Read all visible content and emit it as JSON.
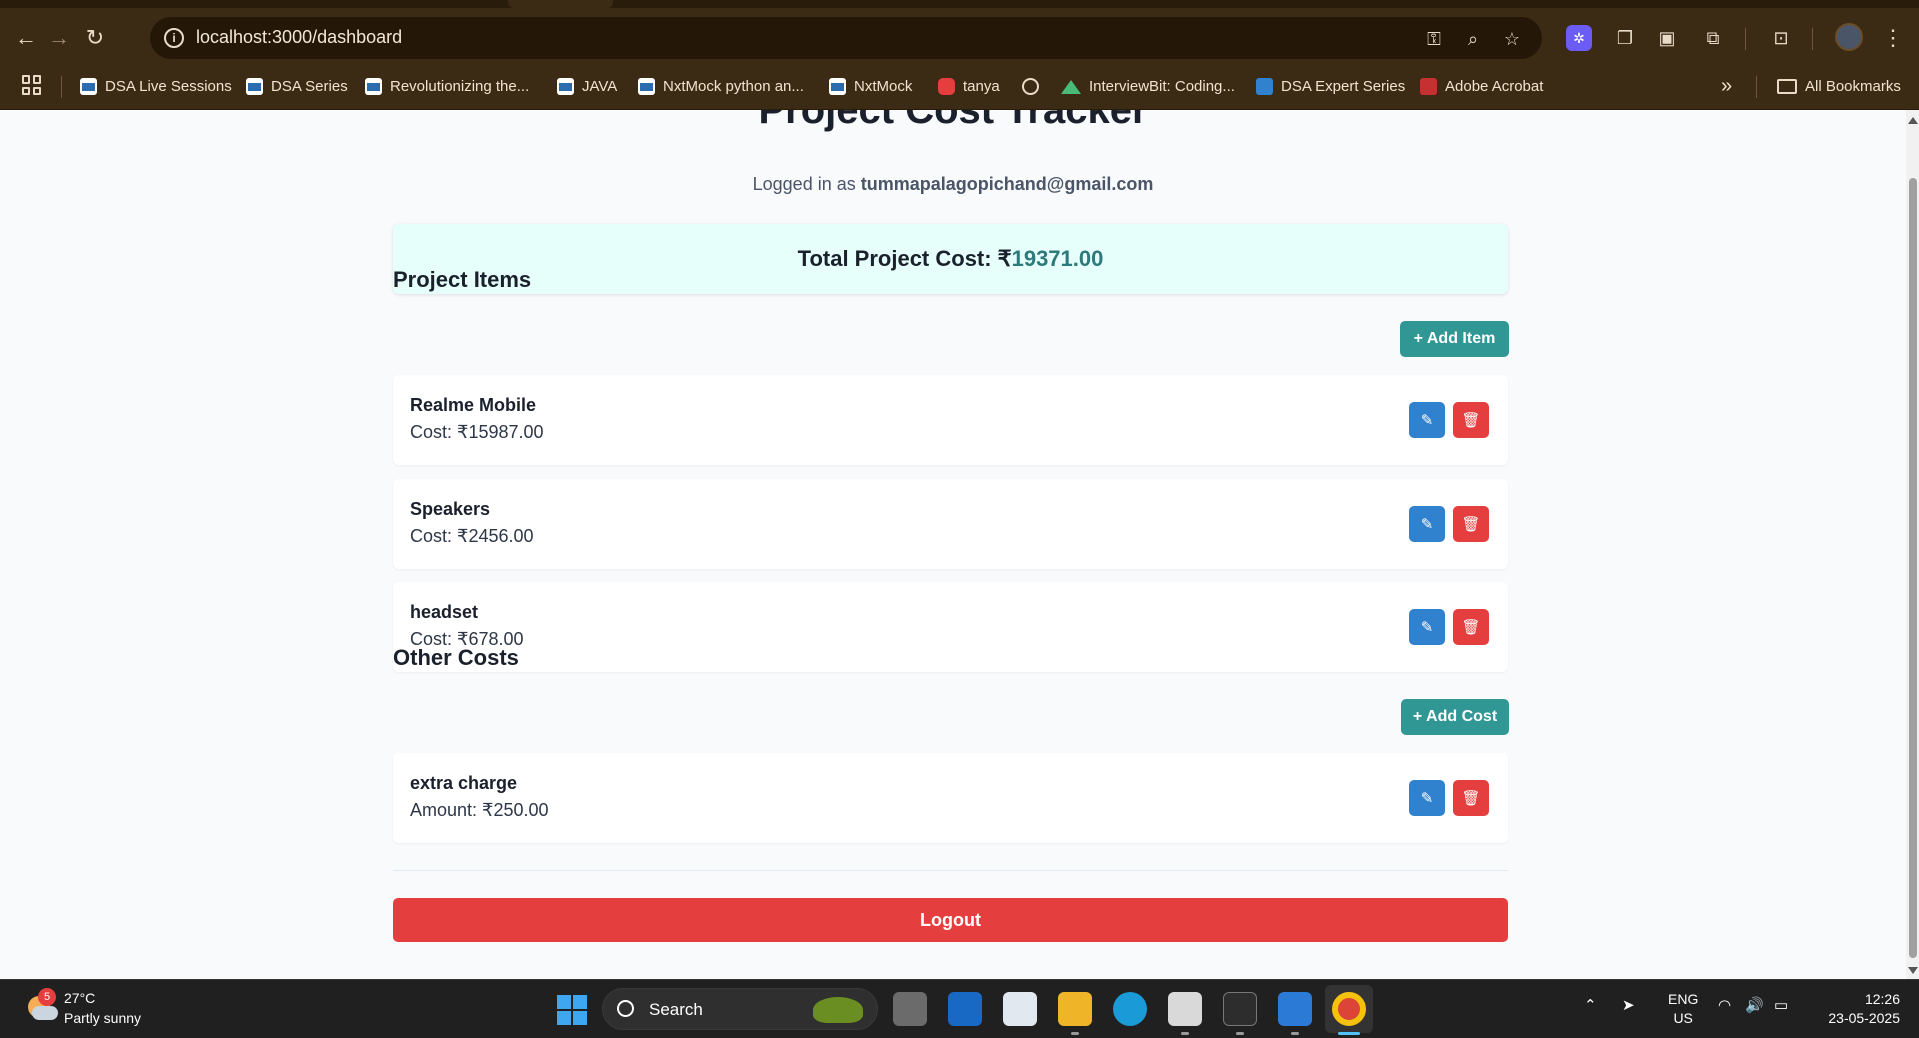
{
  "browser": {
    "url": "localhost:3000/dashboard",
    "bookmarks": [
      {
        "label": "DSA Live Sessions",
        "icon": "nxtwave-favicon"
      },
      {
        "label": "DSA Series",
        "icon": "nxtwave-favicon"
      },
      {
        "label": "Revolutionizing the...",
        "icon": "nxtwave-favicon"
      },
      {
        "label": "JAVA",
        "icon": "nxtwave-favicon"
      },
      {
        "label": "NxtMock python an...",
        "icon": "nxtwave-favicon"
      },
      {
        "label": "NxtMock",
        "icon": "nxtwave-favicon"
      },
      {
        "label": "tanya",
        "icon": "youtube-favicon"
      },
      {
        "label": "InterviewBit: Coding...",
        "icon": "interviewbit-favicon"
      },
      {
        "label": "DSA Expert Series",
        "icon": "chart-favicon"
      },
      {
        "label": "Adobe Acrobat",
        "icon": "acrobat-favicon"
      }
    ],
    "all_bookmarks_label": "All Bookmarks",
    "overflow_label": "»"
  },
  "page": {
    "title": "Project Cost Tracker",
    "logged_in_prefix": "Logged in as",
    "user_email": "tummapalagopichand@gmail.com",
    "total_label": "Total Project Cost:",
    "total_currency": "₹",
    "total_value": "19371.00",
    "items_section": {
      "title": "Project Items",
      "add_label": "+ Add Item",
      "rows": [
        {
          "name": "Realme Mobile",
          "cost": "Cost: ₹15987.00"
        },
        {
          "name": "Speakers",
          "cost": "Cost: ₹2456.00"
        },
        {
          "name": "headset",
          "cost": "Cost: ₹678.00"
        }
      ]
    },
    "other_section": {
      "title": "Other Costs",
      "add_label": "+ Add Cost",
      "rows": [
        {
          "name": "extra charge",
          "cost": "Amount: ₹250.00"
        }
      ]
    },
    "logout_label": "Logout"
  },
  "taskbar": {
    "weather_badge": "5",
    "temperature": "27°C",
    "condition": "Partly sunny",
    "search_label": "Search",
    "lang_line1": "ENG",
    "lang_line2": "US",
    "time": "12:26",
    "date": "23-05-2025"
  },
  "colors": {
    "brand_teal": "#319795",
    "edit_blue": "#3182ce",
    "delete_red": "#e53e3e",
    "total_bg": "#e6fffa"
  }
}
